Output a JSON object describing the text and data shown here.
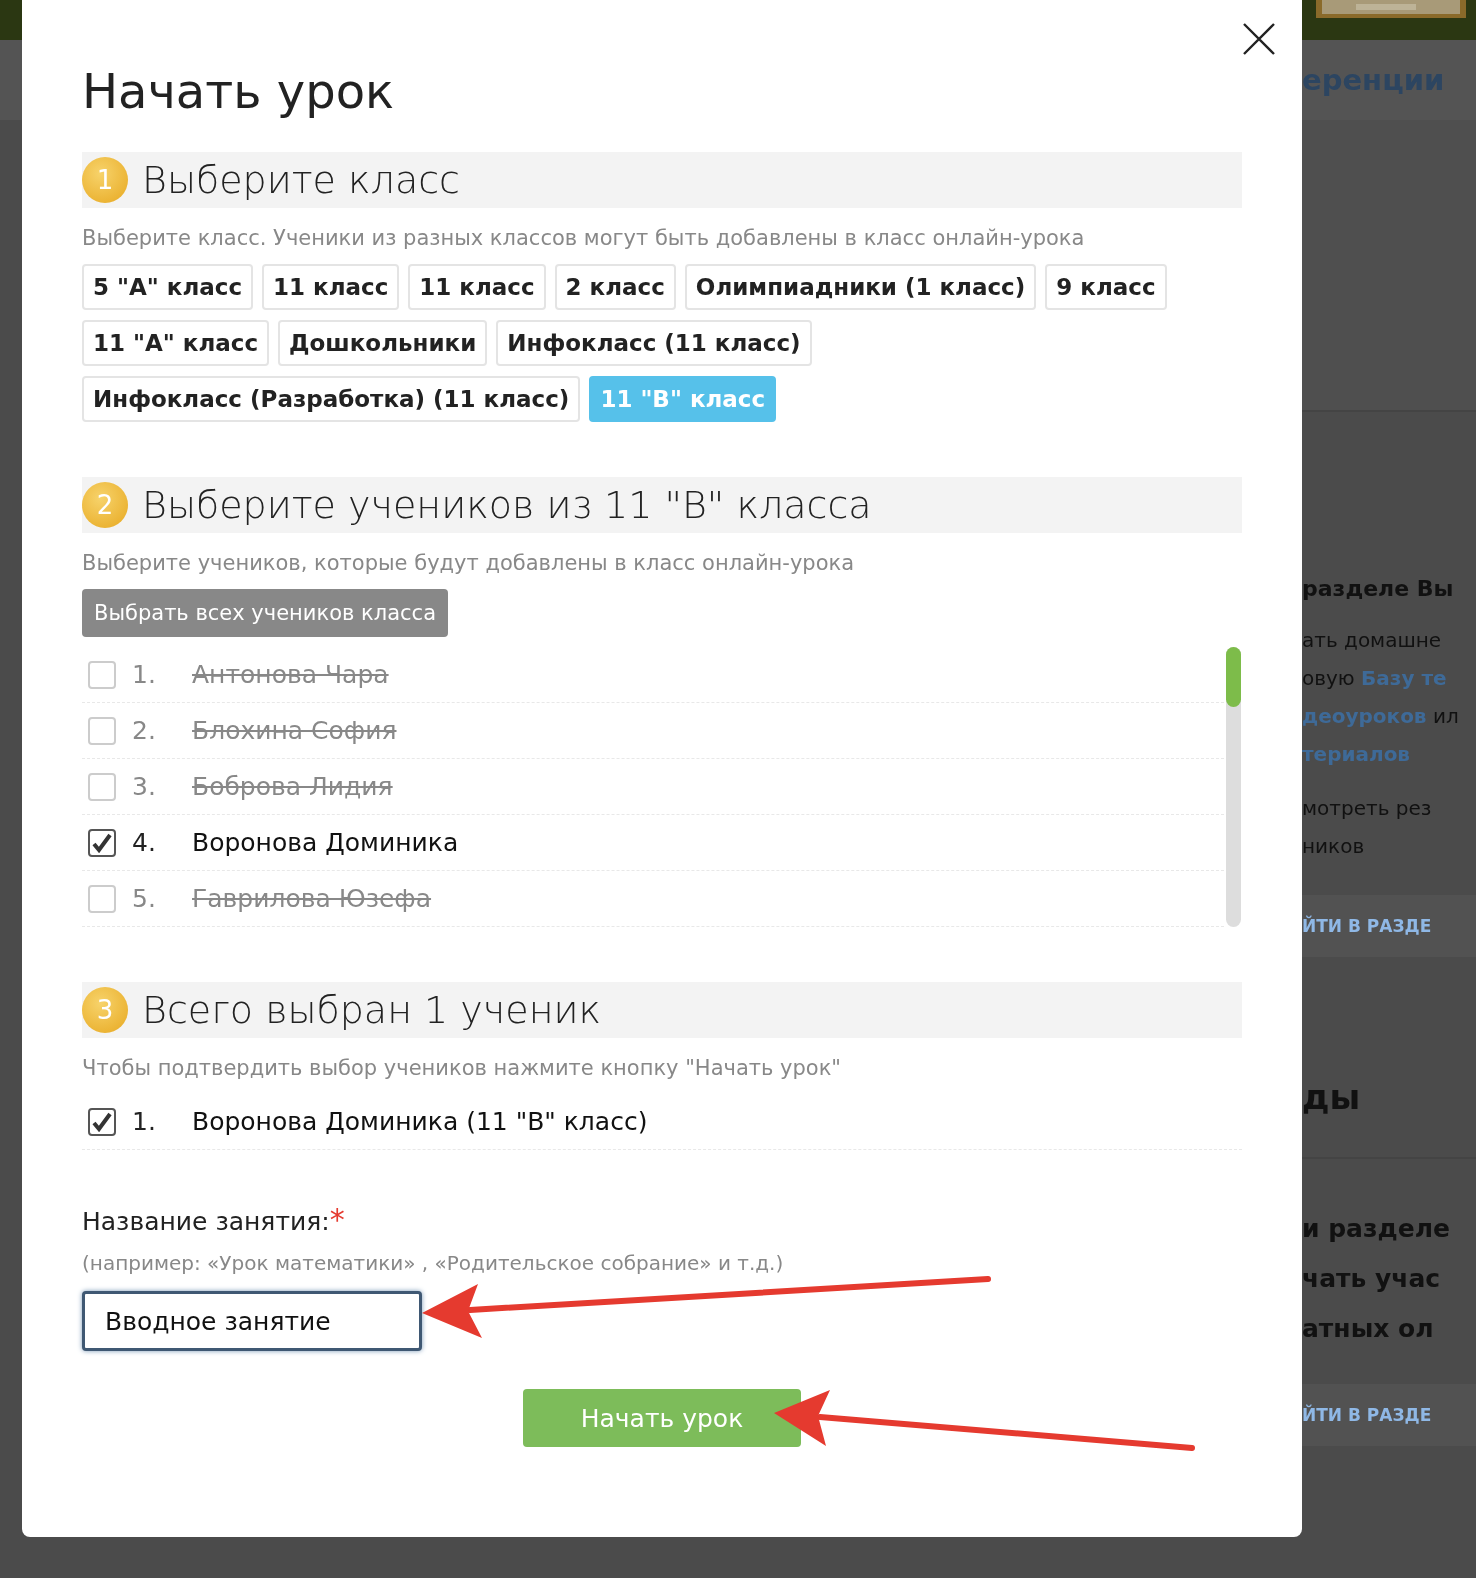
{
  "background_page": {
    "nav_link": "еренции",
    "right_fragments": [
      {
        "text": "разделе Вы",
        "kind": "heading"
      },
      {
        "text": "ать домашне",
        "kind": "text"
      },
      {
        "text": "овую **Базу те**",
        "kind": "text"
      },
      {
        "text": "**деоуроков** ил",
        "kind": "text"
      },
      {
        "text": "**териалов**",
        "kind": "text"
      },
      {
        "text": "мотреть рез",
        "kind": "text"
      },
      {
        "text": "ников",
        "kind": "text"
      },
      {
        "text": "ЙТИ В РАЗДЕ",
        "kind": "button"
      },
      {
        "text": "ды",
        "kind": "title"
      },
      {
        "text": "и разделе",
        "kind": "large"
      },
      {
        "text": "чать учас",
        "kind": "large"
      },
      {
        "text": "атных ол",
        "kind": "large"
      },
      {
        "text": "ЙТИ В РАЗДЕ",
        "kind": "button"
      }
    ]
  },
  "dialog": {
    "title": "Начать урок",
    "steps": [
      {
        "number": "1",
        "title": "Выберите класс",
        "hint": "Выберите класс. Ученики из разных классов могут быть добавлены в класс онлайн-урока"
      },
      {
        "number": "2",
        "title": "Выберите учеников из 11 \"В\" класса",
        "hint": "Выберите учеников, которые будут добавлены в класс онлайн-урока"
      },
      {
        "number": "3",
        "title": "Всего выбран 1 ученик",
        "hint": "Чтобы подтвердить выбор учеников нажмите кнопку \"Начать урок\""
      }
    ],
    "classes": [
      {
        "label": "5 \"А\" класс",
        "selected": false
      },
      {
        "label": "11 класс",
        "selected": false
      },
      {
        "label": "11 класс",
        "selected": false
      },
      {
        "label": "2 класс",
        "selected": false
      },
      {
        "label": "Олимпиадники (1 класс)",
        "selected": false
      },
      {
        "label": "9 класс",
        "selected": false
      },
      {
        "label": "11 \"А\" класс",
        "selected": false
      },
      {
        "label": "Дошкольники",
        "selected": false
      },
      {
        "label": "Инфокласс (11 класс)",
        "selected": false
      },
      {
        "label": "Инфокласс (Разработка) (11 класс)",
        "selected": false
      },
      {
        "label": "11 \"В\" класс",
        "selected": true
      }
    ],
    "select_all_button": "Выбрать всех учеников класса",
    "students": [
      {
        "number": "1.",
        "name": "Антонова Чара",
        "checked": false
      },
      {
        "number": "2.",
        "name": "Блохина София",
        "checked": false
      },
      {
        "number": "3.",
        "name": "Боброва Лидия",
        "checked": false
      },
      {
        "number": "4.",
        "name": "Воронова Доминика",
        "checked": true
      },
      {
        "number": "5.",
        "name": "Гаврилова Юзефа",
        "checked": false
      }
    ],
    "selected_students": [
      {
        "number": "1.",
        "name": "Воронова Доминика (11 \"В\" класс)",
        "checked": true
      }
    ],
    "lesson_name": {
      "label": "Название занятия:",
      "required_mark": "*",
      "hint": "(например: «Урок математики» , «Родительское собрание» и т.д.)",
      "value": "Вводное занятие"
    },
    "start_button": "Начать урок"
  }
}
